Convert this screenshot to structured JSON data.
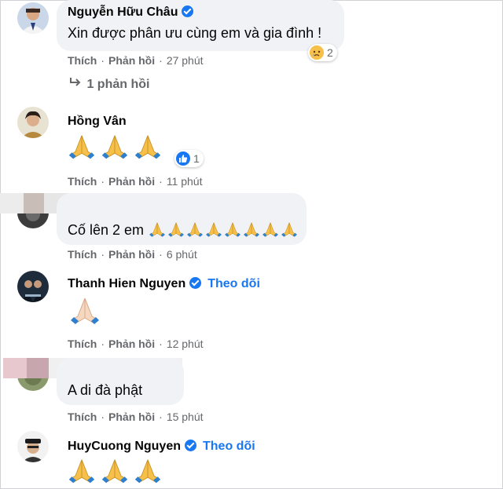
{
  "comments": [
    {
      "author": "Nguyễn Hữu Châu",
      "verified": true,
      "text": "Xin được phân ưu cùng em và gia đình !",
      "like_label": "Thích",
      "reply_label": "Phản hồi",
      "time": "27 phút",
      "reaction_type": "sad",
      "reaction_count": "2",
      "replies_label": "1 phản hồi"
    },
    {
      "author": "Hồng Vân",
      "verified": false,
      "content_emojis": [
        "folded-hands",
        "folded-hands",
        "folded-hands"
      ],
      "like_label": "Thích",
      "reply_label": "Phản hồi",
      "time": "11 phút",
      "reaction_type": "like",
      "reaction_count": "1"
    },
    {
      "author_hidden": true,
      "text": "Cố lên 2 em",
      "content_emojis": [
        "folded-hands",
        "folded-hands",
        "folded-hands",
        "folded-hands",
        "folded-hands",
        "folded-hands",
        "folded-hands",
        "folded-hands"
      ],
      "like_label": "Thích",
      "reply_label": "Phản hồi",
      "time": "6 phút"
    },
    {
      "author": "Thanh Hien Nguyen",
      "verified": true,
      "follow_label": "Theo dõi",
      "content_emojis": [
        "folded-hands-light"
      ],
      "like_label": "Thích",
      "reply_label": "Phản hồi",
      "time": "12 phút"
    },
    {
      "author_hidden": true,
      "text": "A di đà phật",
      "like_label": "Thích",
      "reply_label": "Phản hồi",
      "time": "15 phút"
    },
    {
      "author": "HuyCuong Nguyen",
      "verified": true,
      "follow_label": "Theo dõi",
      "content_emojis": [
        "folded-hands",
        "folded-hands",
        "folded-hands"
      ]
    }
  ],
  "colors": {
    "bubble": "#f0f2f5",
    "meta_text": "#65676b",
    "link_blue": "#1877f2",
    "emoji_yellow": "#f7c04a",
    "emoji_cuff": "#2d7fd0"
  }
}
